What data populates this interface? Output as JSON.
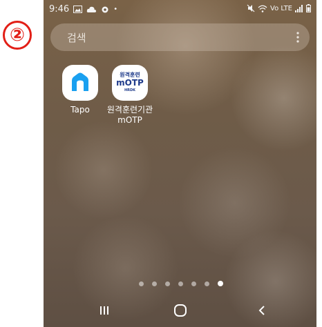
{
  "step_badge": "②",
  "status_bar": {
    "time": "9:46",
    "right_text": "Vo LTE"
  },
  "search": {
    "placeholder": "검색"
  },
  "apps": [
    {
      "label": "Tapo",
      "icon": "tapo-home-icon"
    },
    {
      "label_line1": "원격훈련기관",
      "label_line2": "mOTP",
      "icon": "motp-icon",
      "icon_text_top": "원격훈련",
      "icon_text_mid": "mOTP",
      "icon_text_bot": "HRDK"
    }
  ],
  "page_indicator": {
    "count": 7,
    "active_index": 6
  },
  "colors": {
    "badge_red": "#e21f17",
    "tapo_blue": "#1aa0f0",
    "motp_navy": "#1e3a8a"
  },
  "nav": {
    "recent_icon": "recent-apps-icon",
    "home_icon": "home-icon",
    "back_icon": "back-icon"
  }
}
